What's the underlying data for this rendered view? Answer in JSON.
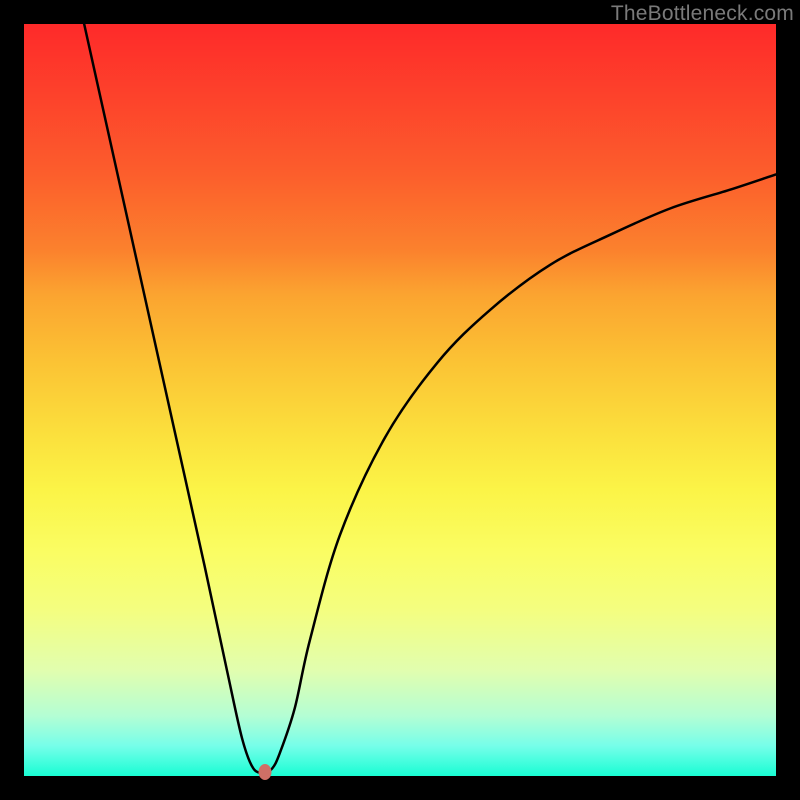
{
  "watermark": "TheBottleneck.com",
  "colors": {
    "top": "#fe2a2a",
    "bottom": "#19fdd4",
    "curve": "#000000",
    "marker": "#cf6f66",
    "frame": "#000000"
  },
  "chart_data": {
    "type": "line",
    "title": "",
    "xlabel": "",
    "ylabel": "",
    "xlim": [
      0,
      100
    ],
    "ylim": [
      0,
      100
    ],
    "grid": false,
    "legend": false,
    "series": [
      {
        "name": "bottleneck-curve",
        "x": [
          8,
          12,
          16,
          20,
          24,
          27,
          29,
          30.5,
          32,
          33,
          34,
          36,
          38,
          42,
          48,
          55,
          62,
          70,
          78,
          86,
          94,
          100
        ],
        "y": [
          100,
          82,
          64,
          46,
          28,
          14,
          5,
          1,
          0.5,
          1,
          3,
          9,
          18,
          32,
          45,
          55,
          62,
          68,
          72,
          75.5,
          78,
          80
        ],
        "note": "values estimated visually; y=0 at bottom (green), y=100 at top (red)"
      }
    ],
    "annotations": [
      {
        "name": "minimum-marker",
        "x": 32,
        "y": 0.5
      }
    ]
  }
}
